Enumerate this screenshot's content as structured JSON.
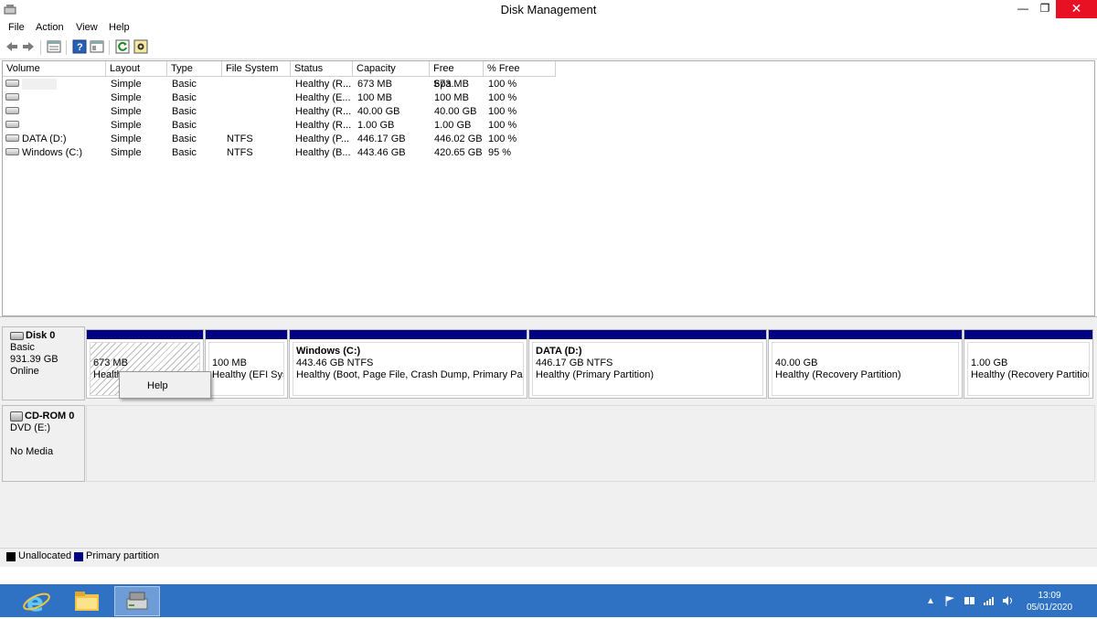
{
  "window": {
    "title": "Disk Management",
    "minimize": "—",
    "restore": "❐",
    "close": "✕"
  },
  "menu": [
    "File",
    "Action",
    "View",
    "Help"
  ],
  "toolbar_icons": [
    "back-arrow-icon",
    "forward-arrow-icon",
    "disk-list-icon",
    "help-icon",
    "properties-icon",
    "refresh-icon",
    "settings-icon"
  ],
  "volume_list": {
    "columns": [
      "Volume",
      "Layout",
      "Type",
      "File System",
      "Status",
      "Capacity",
      "Free Spa...",
      "% Free"
    ],
    "rows": [
      [
        "",
        "Simple",
        "Basic",
        "",
        "Healthy (R...",
        "673 MB",
        "673 MB",
        "100 %"
      ],
      [
        "",
        "Simple",
        "Basic",
        "",
        "Healthy (E...",
        "100 MB",
        "100 MB",
        "100 %"
      ],
      [
        "",
        "Simple",
        "Basic",
        "",
        "Healthy (R...",
        "40.00 GB",
        "40.00 GB",
        "100 %"
      ],
      [
        "",
        "Simple",
        "Basic",
        "",
        "Healthy (R...",
        "1.00 GB",
        "1.00 GB",
        "100 %"
      ],
      [
        "DATA (D:)",
        "Simple",
        "Basic",
        "NTFS",
        "Healthy (P...",
        "446.17 GB",
        "446.02 GB",
        "100 %"
      ],
      [
        "Windows (C:)",
        "Simple",
        "Basic",
        "NTFS",
        "Healthy (B...",
        "443.46 GB",
        "420.65 GB",
        "95 %"
      ]
    ]
  },
  "disk0": {
    "name": "Disk 0",
    "type": "Basic",
    "size": "931.39 GB",
    "state": "Online",
    "partitions": [
      {
        "title": "",
        "size": "673 MB",
        "status": "Healthy"
      },
      {
        "title": "",
        "size": "100 MB",
        "status": "Healthy (EFI Syste"
      },
      {
        "title": "Windows  (C:)",
        "size": "443.46 GB NTFS",
        "status": "Healthy (Boot, Page File, Crash Dump, Primary Partitic"
      },
      {
        "title": "DATA  (D:)",
        "size": "446.17 GB NTFS",
        "status": "Healthy (Primary Partition)"
      },
      {
        "title": "",
        "size": "40.00 GB",
        "status": "Healthy (Recovery Partition)"
      },
      {
        "title": "",
        "size": "1.00 GB",
        "status": "Healthy (Recovery Partition)"
      }
    ]
  },
  "cdrom0": {
    "name": "CD-ROM 0",
    "drive": "DVD (E:)",
    "media": "No Media"
  },
  "context_menu": {
    "item": "Help"
  },
  "legend": [
    {
      "label": "Unallocated",
      "color": "#000000"
    },
    {
      "label": "Primary partition",
      "color": "#000080"
    }
  ],
  "taskbar": {
    "apps": [
      "internet-explorer-icon",
      "file-explorer-icon",
      "disk-management-icon"
    ],
    "clock_time": "13:09",
    "clock_date": "05/01/2020"
  },
  "colors": {
    "partition_bar": "#000080",
    "taskbar": "#2f72c4",
    "close_button": "#e81123"
  }
}
